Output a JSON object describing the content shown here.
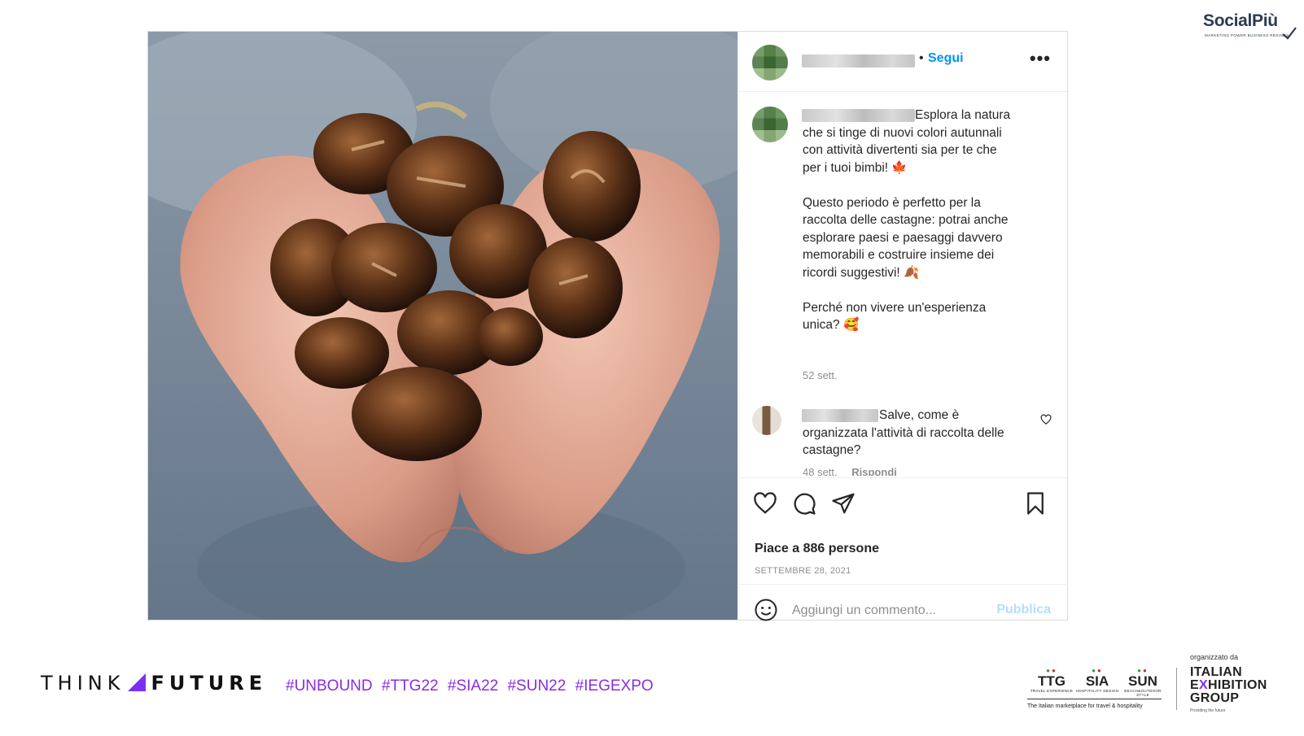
{
  "brand": {
    "name": "SocialPiù",
    "tagline": "MARKETING POWER BUSINESS RESULTS"
  },
  "post": {
    "header": {
      "separator": "•",
      "follow_label": "Segui",
      "more_icon": "more-dots-icon"
    },
    "caption": {
      "text": "Esplora la natura\nche si tinge di nuovi colori autunnali\ncon attività divertenti sia per te che\nper i tuoi bimbi! 🍁\n\nQuesto periodo è perfetto per la\nraccolta delle castagne: potrai anche\nesplorare paesi e paesaggi davvero\nmemorabili e costruire insieme dei\nricordi suggestivi! 🍂\n\nPerché non vivere un'esperienza\nunica? 🥰",
      "time": "52 sett."
    },
    "comment": {
      "text": "Salve, come è\norganizzata l'attività di raccolta delle\ncastagne?",
      "time": "48 sett.",
      "reply_label": "Rispondi"
    },
    "actions": {
      "icons": [
        "heart-icon",
        "comment-icon",
        "share-icon",
        "bookmark-icon"
      ]
    },
    "likes_text": "Piace a 886 persone",
    "date_text": "SETTEMBRE 28, 2021",
    "add_comment": {
      "placeholder": "Aggiungi un commento...",
      "publish_label": "Pubblica"
    }
  },
  "footer": {
    "think": "THINK",
    "future": "FUTURE",
    "hashtags": "#UNBOUND #TTG22 #SIA22 #SUN22 #IEGEXPO",
    "fairs": [
      {
        "name": "TTG",
        "sub": "TRAVEL EXPERIENCE"
      },
      {
        "name": "SIA",
        "sub": "HOSPITALITY DESIGN"
      },
      {
        "name": "SUN",
        "sub": "BEACH&OUTDOOR STYLE"
      }
    ],
    "fairs_tagline": "The Italian marketplace for travel & hospitality",
    "organizer_label": "organizzato da",
    "organizer_line1": "ITALIAN",
    "organizer_line2_a": "E",
    "organizer_line2_x": "X",
    "organizer_line2_b": "HIBITION",
    "organizer_line3": "GROUP",
    "organizer_tag": "Providing the future"
  },
  "colors": {
    "link_blue": "#0095f6",
    "publish_disabled": "#b2dffc",
    "hashtag_purple": "#8a2be2",
    "accent_purple": "#7b2ff2"
  }
}
